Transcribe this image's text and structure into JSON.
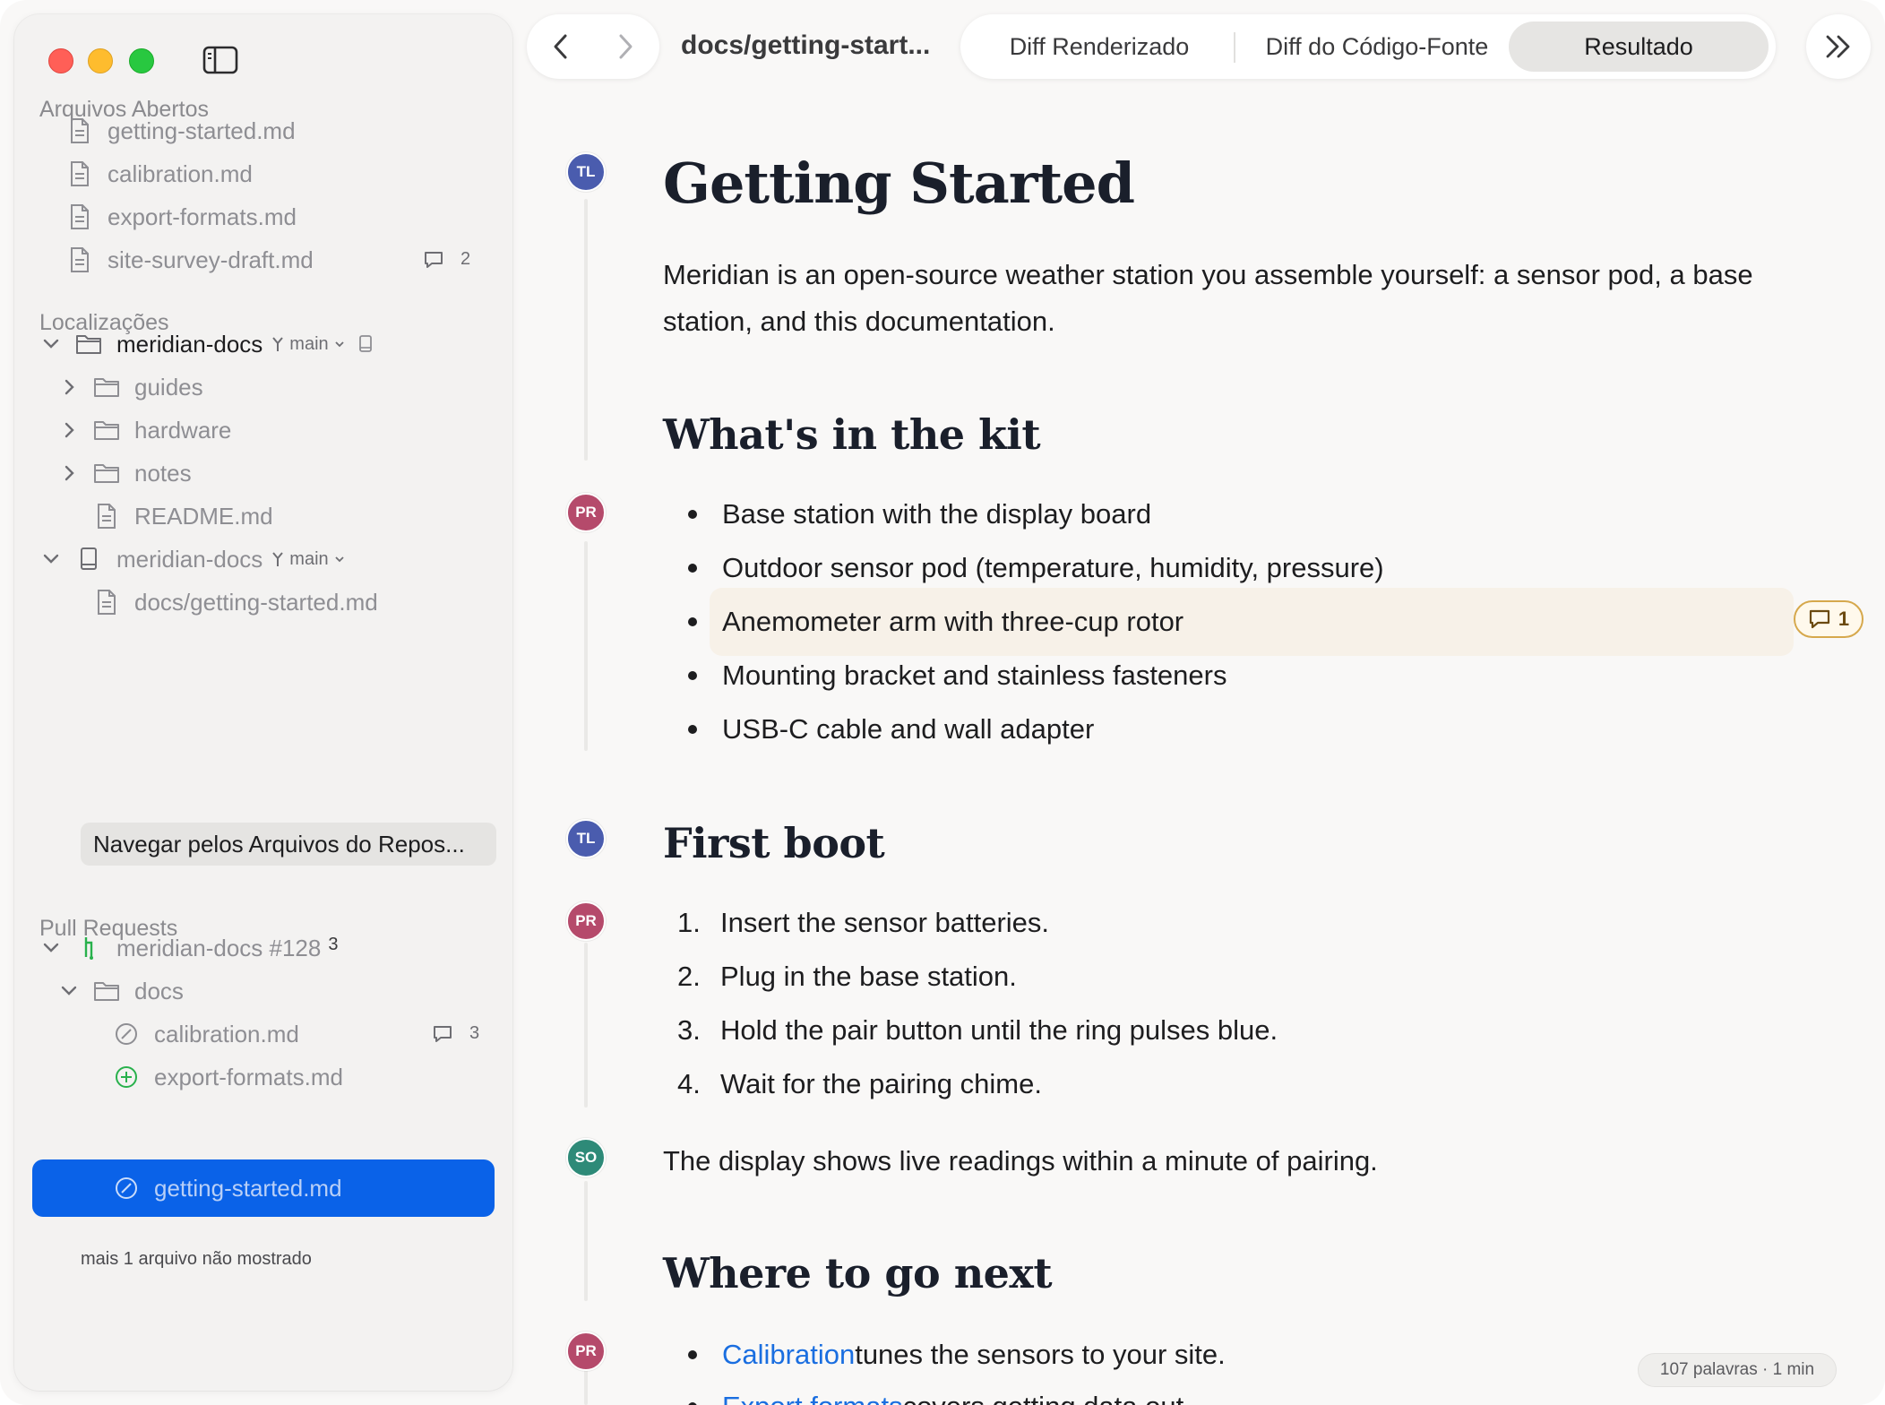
{
  "toolbar": {
    "title": "docs/getting-start...",
    "segments": [
      "Diff Renderizado",
      "Diff do Código-Fonte",
      "Resultado"
    ],
    "active_segment": "Resultado"
  },
  "sidebar": {
    "open_files_header": "Arquivos Abertos",
    "open_files": [
      {
        "name": "getting-started.md"
      },
      {
        "name": "calibration.md"
      },
      {
        "name": "export-formats.md"
      },
      {
        "name": "site-survey-draft.md",
        "comments": "2"
      }
    ],
    "locations_header": "Localizações",
    "repo1": {
      "name": "meridian-docs",
      "branch": "main"
    },
    "repo1_children": [
      "guides",
      "hardware",
      "notes",
      "README.md"
    ],
    "repo2": {
      "name": "meridian-docs",
      "branch": "main"
    },
    "repo2_file": "docs/getting-started.md",
    "browse_button": "Navegar pelos Arquivos do Repos...",
    "pr_header": "Pull Requests",
    "pr": {
      "name": "meridian-docs #128",
      "count": "3"
    },
    "pr_folder": "docs",
    "pr_files": [
      {
        "name": "calibration.md",
        "status": "modified",
        "comments": "3"
      },
      {
        "name": "export-formats.md",
        "status": "added"
      },
      {
        "name": "getting-started.md",
        "status": "modified",
        "selected": true
      }
    ],
    "more_note": "mais 1 arquivo não mostrado"
  },
  "document": {
    "title": "Getting Started",
    "intro": "Meridian is an open-source weather station you assemble yourself: a sensor pod, a base station, and this documentation.",
    "kit_heading": "What's in the kit",
    "kit_items": [
      "Base station with the display board",
      "Outdoor sensor pod (temperature, humidity, pressure)",
      "Anemometer arm with three-cup rotor",
      "Mounting bracket and stainless fasteners",
      "USB-C cable and wall adapter"
    ],
    "kit_comment_count": "1",
    "boot_heading": "First boot",
    "boot_steps": [
      "Insert the sensor batteries.",
      "Plug in the base station.",
      "Hold the pair button until the ring pulses blue.",
      "Wait for the pairing chime."
    ],
    "boot_numbers": [
      "1.",
      "2.",
      "3.",
      "4."
    ],
    "boot_note": "The display shows live readings within a minute of pairing.",
    "next_heading": "Where to go next",
    "next_items": [
      {
        "link": "Calibration",
        "text": " tunes the sensors to your site."
      },
      {
        "link": "Export formats",
        "text": " covers getting data out."
      }
    ],
    "authors": [
      "TL",
      "PR",
      "TL",
      "PR",
      "SO",
      "PR"
    ]
  },
  "status": {
    "word_count": "107 palavras · 1 min"
  },
  "colors": {
    "accent": "#0a62e8",
    "avatar_tl": "#4a5cae",
    "avatar_pr": "#b54a6b",
    "avatar_so": "#2e8a78",
    "link": "#1a6ee0"
  }
}
